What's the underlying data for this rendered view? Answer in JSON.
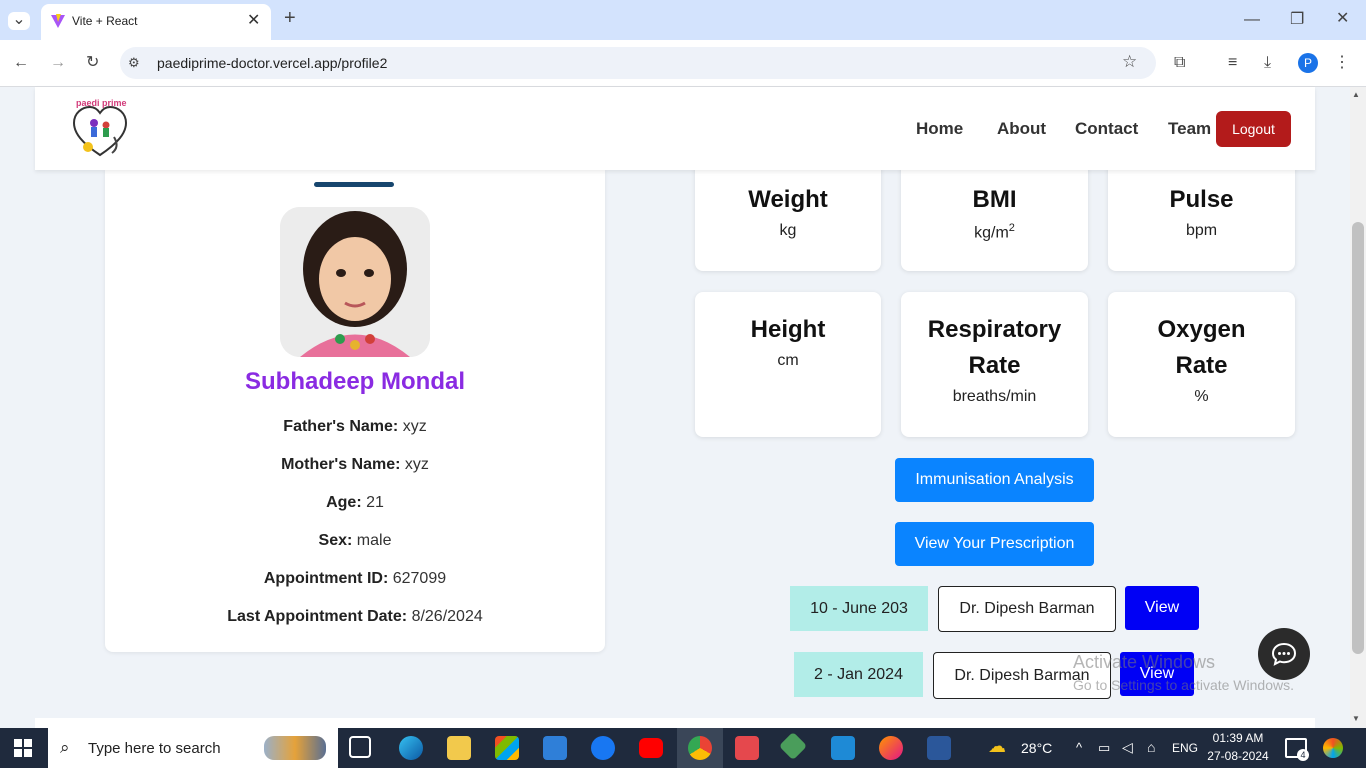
{
  "browser": {
    "tab_title": "Vite + React",
    "url": "paediprime-doctor.vercel.app/profile2",
    "profile_initial": "P"
  },
  "navbar": {
    "links": [
      "Home",
      "About",
      "Contact",
      "Team"
    ],
    "logout_label": "Logout"
  },
  "profile": {
    "name": "Subhadeep Mondal",
    "fields": [
      {
        "label": "Father's Name:",
        "value": "xyz"
      },
      {
        "label": "Mother's Name:",
        "value": "xyz"
      },
      {
        "label": "Age:",
        "value": "21"
      },
      {
        "label": "Sex:",
        "value": "male"
      },
      {
        "label": "Appointment ID:",
        "value": "627099"
      },
      {
        "label": "Last Appointment Date:",
        "value": "8/26/2024"
      }
    ]
  },
  "vitals": [
    {
      "title": "Weight",
      "unit": "kg"
    },
    {
      "title": "BMI",
      "unit": "kg/m",
      "unit_sup": "2"
    },
    {
      "title": "Pulse",
      "unit": "bpm"
    },
    {
      "title": "Height",
      "unit": "cm"
    },
    {
      "title": "Respiratory Rate",
      "unit": "breaths/min"
    },
    {
      "title": "Oxygen Rate",
      "unit": "%"
    }
  ],
  "actions": {
    "immunisation_label": "Immunisation Analysis",
    "prescription_label": "View Your Prescription"
  },
  "appointments": [
    {
      "date": "10 - June 203",
      "doctor": "Dr. Dipesh Barman",
      "view_label": "View"
    },
    {
      "date": "2 - Jan 2024",
      "doctor": "Dr. Dipesh Barman",
      "view_label": "View"
    }
  ],
  "watermark": {
    "line1": "Activate Windows",
    "line2": "Go to Settings to activate Windows."
  },
  "taskbar": {
    "search_placeholder": "Type here to search",
    "weather": "28°C",
    "language": "ENG",
    "time": "01:39 AM",
    "date": "27-08-2024",
    "notification_count": "4"
  }
}
